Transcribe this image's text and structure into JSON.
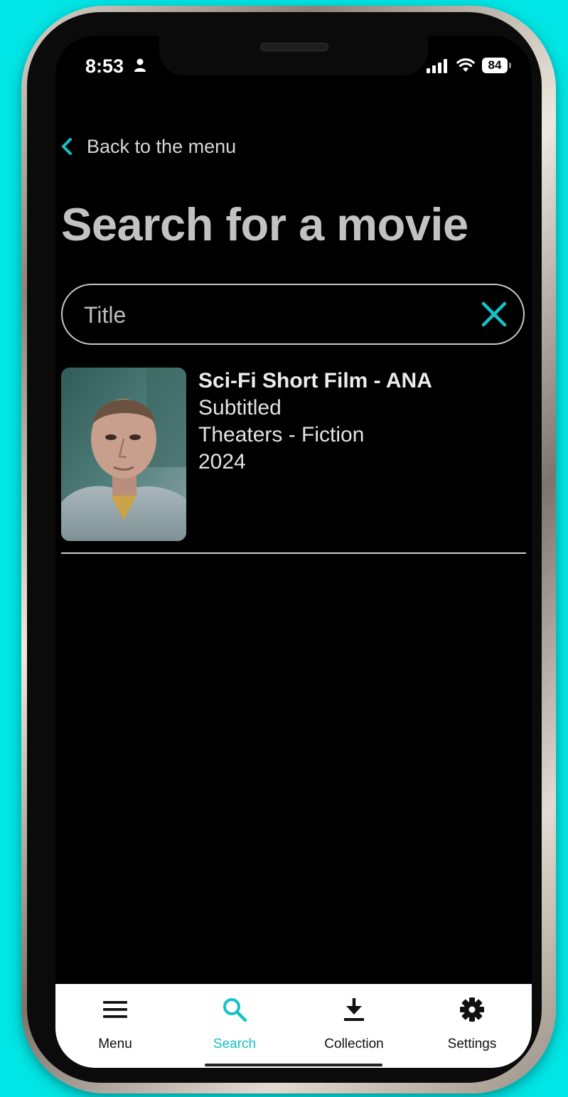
{
  "status_bar": {
    "time": "8:53",
    "battery": "84",
    "icons": [
      "person-icon",
      "signal-icon",
      "wifi-icon",
      "battery-icon"
    ]
  },
  "nav": {
    "back_label": "Back to the menu",
    "back_icon": "chevron-left-icon"
  },
  "page": {
    "title": "Search for a movie"
  },
  "search": {
    "placeholder": "Title",
    "value": "",
    "clear_icon": "close-icon"
  },
  "results": [
    {
      "title": "Sci-Fi Short Film - ANA",
      "subtitle_status": "Subtitled",
      "category": "Theaters - Fiction",
      "year": "2024",
      "poster_icon": "movie-poster"
    }
  ],
  "tab_bar": {
    "active": "Search",
    "tabs": [
      {
        "label": "Menu",
        "icon": "hamburger-icon"
      },
      {
        "label": "Search",
        "icon": "search-icon"
      },
      {
        "label": "Collection",
        "icon": "download-icon"
      },
      {
        "label": "Settings",
        "icon": "gear-icon"
      }
    ]
  },
  "colors": {
    "accent": "#13c3c8",
    "background_outer": "#00e5e5",
    "screen_background": "#000000",
    "title_text": "#c2c2c2"
  }
}
